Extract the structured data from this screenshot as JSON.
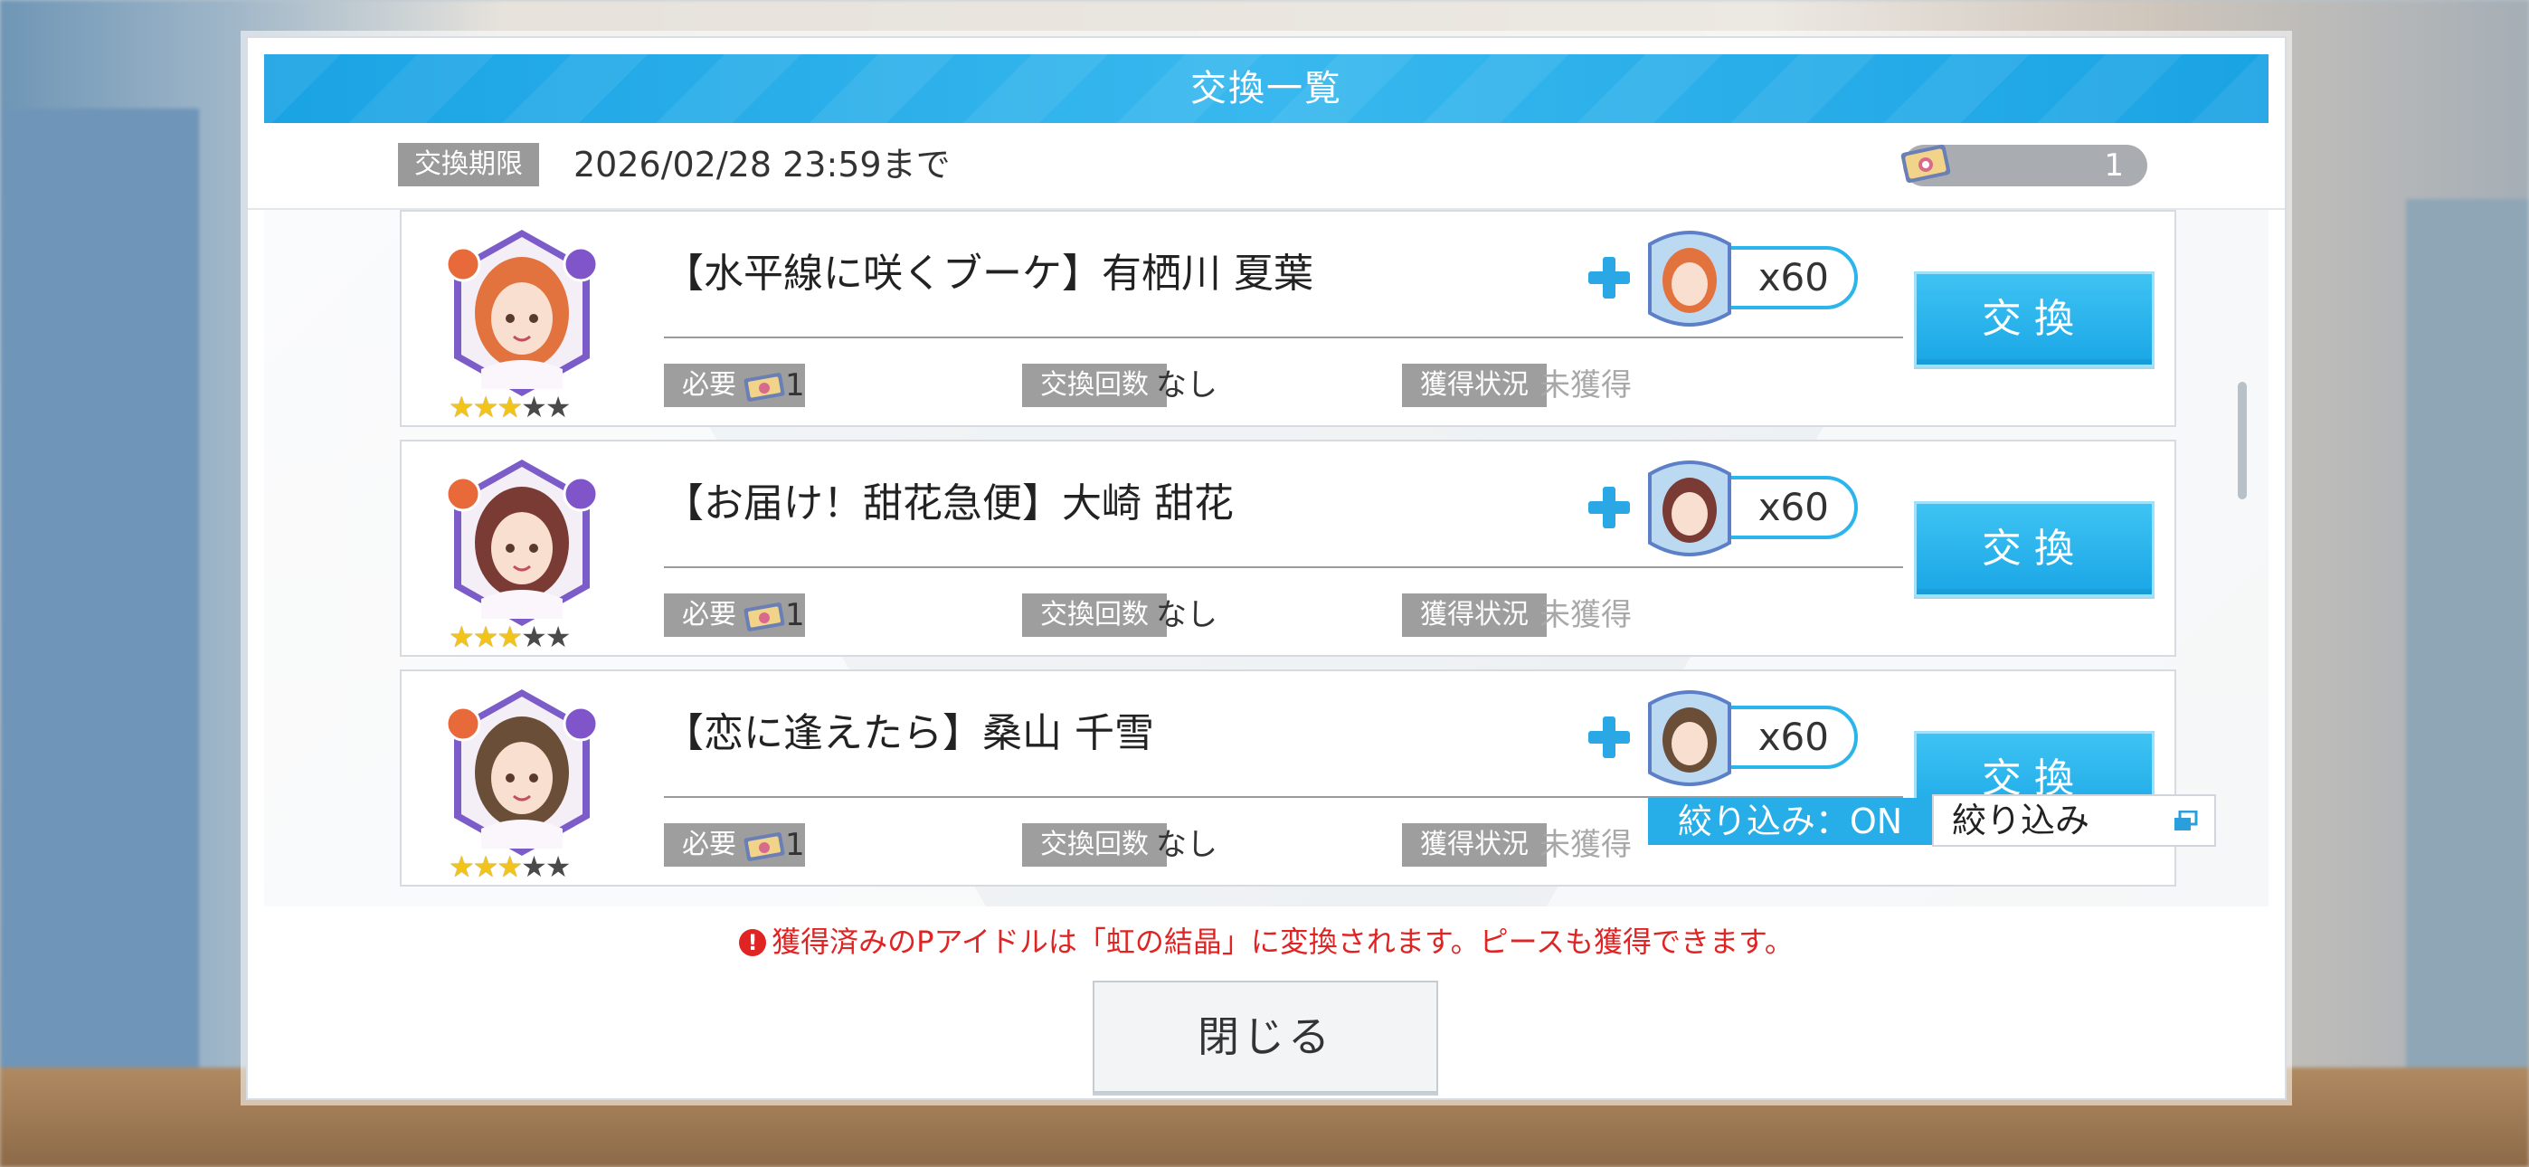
{
  "dialog": {
    "title": "交換一覧"
  },
  "period": {
    "label": "交換期限",
    "value": "2026/02/28 23:59まで"
  },
  "owned_items": {
    "count": "1",
    "icon": "exchange-ticket-icon"
  },
  "cards": [
    {
      "name": "【水平線に咲くブーケ】有栖川 夏葉",
      "rarity": 3,
      "max_rarity": 5,
      "reward_amount": "x60",
      "required_label": "必要",
      "required_value": "1",
      "exchange_count_label": "交換回数",
      "exchange_count_value": "なし",
      "status_label": "獲得状況",
      "status_value": "未獲得",
      "button_label": "交換",
      "hair_color": "#e2733f",
      "frame_color": "#7b5cc8"
    },
    {
      "name": "【お届け！甜花急便】大崎 甜花",
      "rarity": 3,
      "max_rarity": 5,
      "reward_amount": "x60",
      "required_label": "必要",
      "required_value": "1",
      "exchange_count_label": "交換回数",
      "exchange_count_value": "なし",
      "status_label": "獲得状況",
      "status_value": "未獲得",
      "button_label": "交換",
      "hair_color": "#7a3b35",
      "frame_color": "#7b5cc8"
    },
    {
      "name": "【恋に逢えたら】桑山 千雪",
      "rarity": 3,
      "max_rarity": 5,
      "reward_amount": "x60",
      "required_label": "必要",
      "required_value": "1",
      "exchange_count_label": "交換回数",
      "exchange_count_value": "なし",
      "status_label": "獲得状況",
      "status_value": "未獲得",
      "button_label": "交換",
      "hair_color": "#6b4e37",
      "frame_color": "#7b5cc8"
    }
  ],
  "filter": {
    "status": "絞り込み：ON",
    "button_label": "絞り込み"
  },
  "notice": "獲得済みのPアイドルは「虹の結晶」に変換されます。ピースも獲得できます。",
  "close_button": "閉じる",
  "colors": {
    "accent": "#27aee8",
    "warning": "#e02424",
    "tag": "#9e9e9e"
  }
}
